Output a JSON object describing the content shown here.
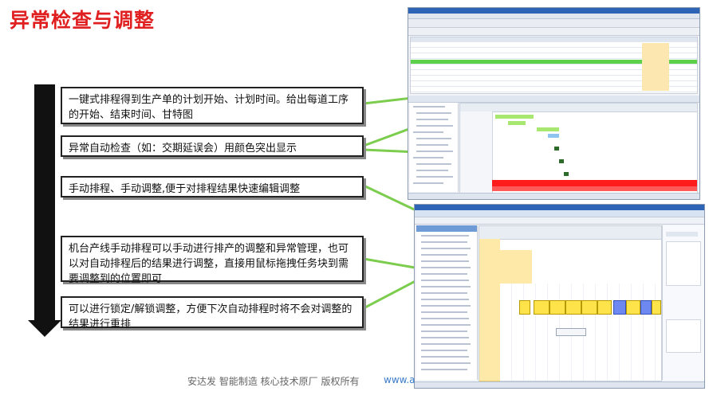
{
  "title": "异常检查与调整",
  "callouts": [
    "一键式排程得到生产单的计划开始、计划时间。给出每道工序的开始、结束时间、甘特图",
    "异常自动检查（如：交期延误会）用颜色突出显示",
    "手动排程、手动调整,便于对排程结果快速编辑调整",
    "机台产线手动排程可以手动进行排产的调整和异常管理，也可以对自动排程后的结果进行调整，直接用鼠标拖拽任务块到需要调整到的位置即可",
    "可以进行锁定/解锁调整，方便下次自动排程时将不会对调整的结果进行重排"
  ],
  "footer": {
    "text": "安达发  智能制造 核心技术原厂  版权所有",
    "url": "www.a"
  },
  "colors": {
    "title": "#e02020",
    "connector": "#7ccd4e",
    "highlight_row": "#5ed14a",
    "alert_row": "#ff1c1c",
    "gantt_bar": "#a9e870",
    "task_yellow": "#ffe34a",
    "task_blue": "#6d88f0"
  },
  "chart_data": [
    {
      "type": "table",
      "screen": "aps-order-list-and-gantt",
      "rows_visible": 9,
      "highlighted_row": 4
    },
    {
      "type": "table",
      "screen": "machine-manual-scheduling",
      "task_blocks": 10
    }
  ]
}
